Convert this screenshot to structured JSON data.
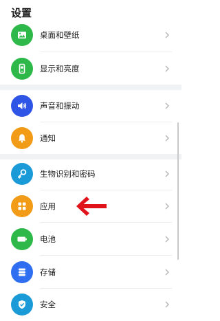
{
  "header": {
    "title": "设置"
  },
  "items": [
    {
      "label": "桌面和壁纸",
      "icon": "wallpaper-icon",
      "color": "#2fb84a"
    },
    {
      "label": "显示和亮度",
      "icon": "phone-brightness-icon",
      "color": "#2fb84a"
    },
    {
      "label": "声音和振动",
      "icon": "speaker-icon",
      "color": "#2f55e6"
    },
    {
      "label": "通知",
      "icon": "bell-icon",
      "color": "#f29b16"
    },
    {
      "label": "生物识别和密码",
      "icon": "key-icon",
      "color": "#1a9bd8"
    },
    {
      "label": "应用",
      "icon": "apps-grid-icon",
      "color": "#f29b16"
    },
    {
      "label": "电池",
      "icon": "battery-icon",
      "color": "#2fb84a"
    },
    {
      "label": "存储",
      "icon": "storage-icon",
      "color": "#2f6ef0"
    },
    {
      "label": "安全",
      "icon": "shield-icon",
      "color": "#1a9bd8"
    }
  ],
  "annotation": {
    "icon": "red-arrow-icon",
    "color": "#e0121a"
  }
}
